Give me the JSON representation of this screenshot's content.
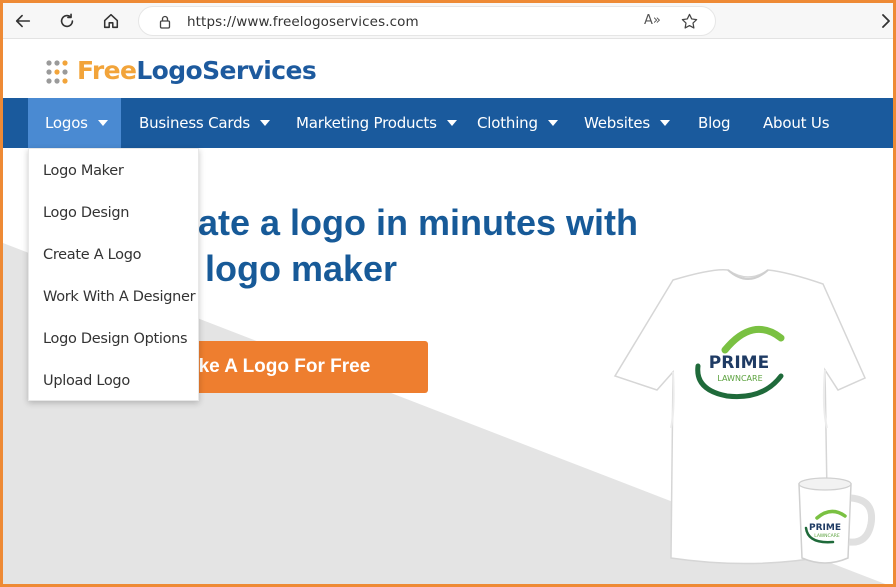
{
  "browser": {
    "url": "https://www.freelogoservices.com",
    "read_aloud": "A»",
    "icons": {
      "back": "back-arrow-icon",
      "refresh": "refresh-icon",
      "home": "home-icon",
      "lock": "lock-icon",
      "favorite": "star-icon",
      "more": "chevron-right-icon"
    }
  },
  "site": {
    "logo_part1": "Free",
    "logo_part2": "LogoServices",
    "colors": {
      "nav_bg": "#1a5a9d",
      "nav_active": "#4a8ad2",
      "brand_orange": "#f2a43a",
      "brand_blue": "#1d5a9e",
      "cta": "#ee7e2f",
      "title": "#175a98"
    }
  },
  "nav": {
    "items": [
      {
        "label": "Logos"
      },
      {
        "label": "Business Cards"
      },
      {
        "label": "Marketing Products"
      },
      {
        "label": "Clothing"
      },
      {
        "label": "Websites"
      },
      {
        "label": "Blog"
      },
      {
        "label": "About Us"
      }
    ]
  },
  "dropdown": {
    "items": [
      {
        "label": "Logo Maker"
      },
      {
        "label": "Logo Design"
      },
      {
        "label": "Create A Logo"
      },
      {
        "label": "Work With A Designer"
      },
      {
        "label": "Logo Design Options"
      },
      {
        "label": "Upload Logo"
      }
    ]
  },
  "hero": {
    "title_line1": "ate a logo in minutes with",
    "title_line2": "logo maker",
    "cta_label": "ake A Logo For Free",
    "tshirt_logo_line1": "PRIME",
    "tshirt_logo_line2": "LAWNCARE",
    "mug_logo_line1": "PRIME",
    "mug_logo_line2": "LAWNCARE"
  }
}
